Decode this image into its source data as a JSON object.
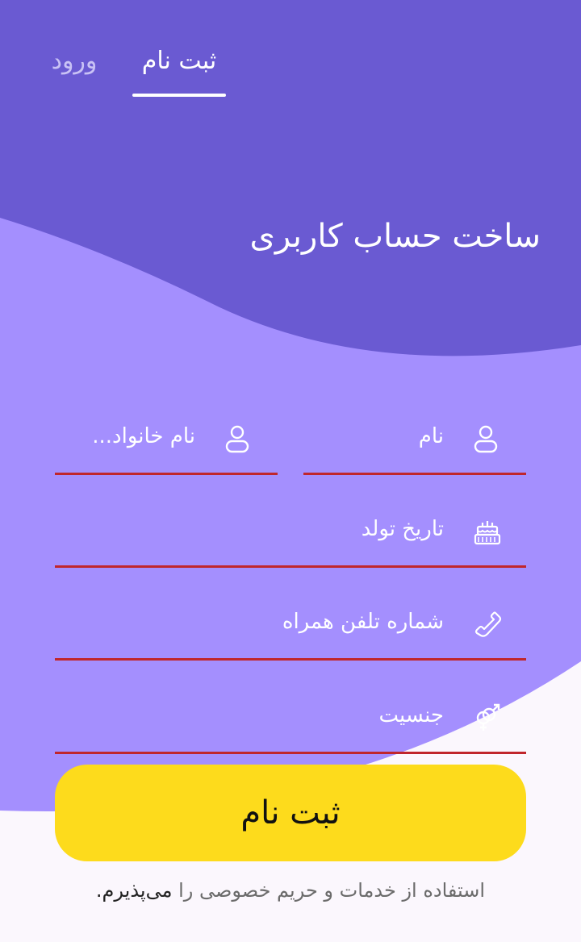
{
  "tabs": {
    "register": "ثبت نام",
    "login": "ورود"
  },
  "title": "ساخت حساب کاربری",
  "fields": {
    "first_name": "نام",
    "last_name": "نام خانواد...",
    "birth_date": "تاریخ تولد",
    "phone": "شماره تلفن همراه",
    "gender": "جنسیت"
  },
  "submit_label": "ثبت نام",
  "terms": {
    "text": "استفاده از خدمات و حریم خصوصی را ",
    "accept": "می‌پذیرم."
  },
  "colors": {
    "header": "#6a5ad2",
    "form_bg": "#a48ffe",
    "underline": "#c0262c",
    "button": "#fddb1c"
  }
}
